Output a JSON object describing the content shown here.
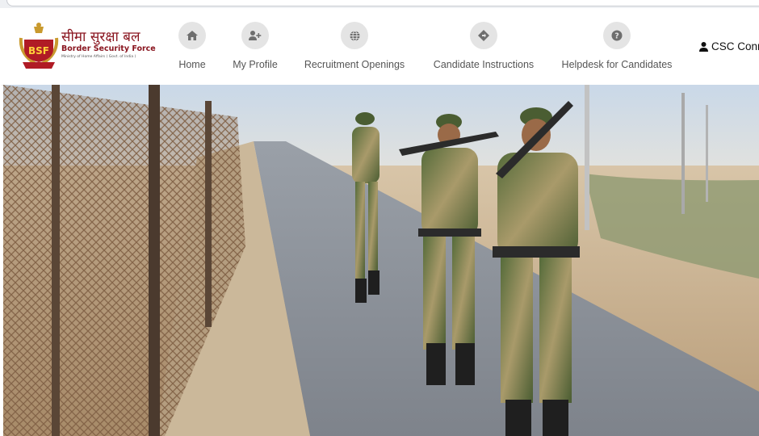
{
  "header": {
    "logo": {
      "badge_text": "BSF",
      "hindi_name": "सीमा सुरक्षा बल",
      "english_name": "Border Security Force",
      "ministry": "Ministry of Home Affairs ( Govt. of India )"
    },
    "nav": [
      {
        "label": "Home",
        "icon": "home-icon"
      },
      {
        "label": "My Profile",
        "icon": "user-plus-icon"
      },
      {
        "label": "Recruitment Openings",
        "icon": "globe-icon"
      },
      {
        "label": "Candidate Instructions",
        "icon": "diamond-direction-icon"
      },
      {
        "label": "Helpdesk for Candidates",
        "icon": "question-circle-icon"
      }
    ],
    "user_label": "CSC Conn"
  },
  "hero": {
    "image": "hero-photo-soldiers-border-patrol"
  },
  "colors": {
    "brand_maroon": "#8a1620",
    "nav_circle": "#e4e4e4",
    "nav_icon": "#6e6e6e"
  }
}
